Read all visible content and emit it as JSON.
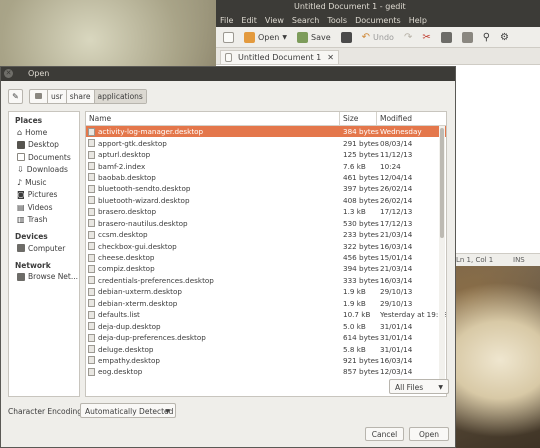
{
  "gedit": {
    "title": "Untitled Document 1 - gedit",
    "menu": [
      "File",
      "Edit",
      "View",
      "Search",
      "Tools",
      "Documents",
      "Help"
    ],
    "toolbar": {
      "open": "Open",
      "save": "Save",
      "undo": "Undo"
    },
    "tab_label": "Untitled Document 1",
    "status_position": "Ln 1, Col 1",
    "status_mode": "INS"
  },
  "dialog": {
    "title": "Open",
    "path": [
      "usr",
      "share",
      "applications"
    ],
    "places_heading": "Places",
    "places": [
      "Home",
      "Desktop",
      "Documents",
      "Downloads",
      "Music",
      "Pictures",
      "Videos",
      "Trash"
    ],
    "devices_heading": "Devices",
    "devices": [
      "Computer"
    ],
    "network_heading": "Network",
    "network": [
      "Browse Net..."
    ],
    "columns": {
      "name": "Name",
      "size": "Size",
      "modified": "Modified"
    },
    "files": [
      {
        "name": "activity-log-manager.desktop",
        "size": "384 bytes",
        "modified": "Wednesday"
      },
      {
        "name": "apport-gtk.desktop",
        "size": "291 bytes",
        "modified": "08/03/14"
      },
      {
        "name": "apturl.desktop",
        "size": "125 bytes",
        "modified": "11/12/13"
      },
      {
        "name": "bamf-2.index",
        "size": "7.6 kB",
        "modified": "10:24"
      },
      {
        "name": "baobab.desktop",
        "size": "461 bytes",
        "modified": "12/04/14"
      },
      {
        "name": "bluetooth-sendto.desktop",
        "size": "397 bytes",
        "modified": "26/02/14"
      },
      {
        "name": "bluetooth-wizard.desktop",
        "size": "408 bytes",
        "modified": "26/02/14"
      },
      {
        "name": "brasero.desktop",
        "size": "1.3 kB",
        "modified": "17/12/13"
      },
      {
        "name": "brasero-nautilus.desktop",
        "size": "530 bytes",
        "modified": "17/12/13"
      },
      {
        "name": "ccsm.desktop",
        "size": "233 bytes",
        "modified": "21/03/14"
      },
      {
        "name": "checkbox-gui.desktop",
        "size": "322 bytes",
        "modified": "16/03/14"
      },
      {
        "name": "cheese.desktop",
        "size": "456 bytes",
        "modified": "15/01/14"
      },
      {
        "name": "compiz.desktop",
        "size": "394 bytes",
        "modified": "21/03/14"
      },
      {
        "name": "credentials-preferences.desktop",
        "size": "333 bytes",
        "modified": "16/03/14"
      },
      {
        "name": "debian-uxterm.desktop",
        "size": "1.9 kB",
        "modified": "29/10/13"
      },
      {
        "name": "debian-xterm.desktop",
        "size": "1.9 kB",
        "modified": "29/10/13"
      },
      {
        "name": "defaults.list",
        "size": "10.7 kB",
        "modified": "Yesterday at 19:18"
      },
      {
        "name": "deja-dup.desktop",
        "size": "5.0 kB",
        "modified": "31/01/14"
      },
      {
        "name": "deja-dup-preferences.desktop",
        "size": "614 bytes",
        "modified": "31/01/14"
      },
      {
        "name": "deluge.desktop",
        "size": "5.8 kB",
        "modified": "31/01/14"
      },
      {
        "name": "empathy.desktop",
        "size": "921 bytes",
        "modified": "16/03/14"
      },
      {
        "name": "eog.desktop",
        "size": "857 bytes",
        "modified": "12/03/14"
      }
    ],
    "filter": "All Files",
    "encoding_label": "Character Encoding:",
    "encoding_value": "Automatically Detected",
    "cancel": "Cancel",
    "open": "Open"
  }
}
